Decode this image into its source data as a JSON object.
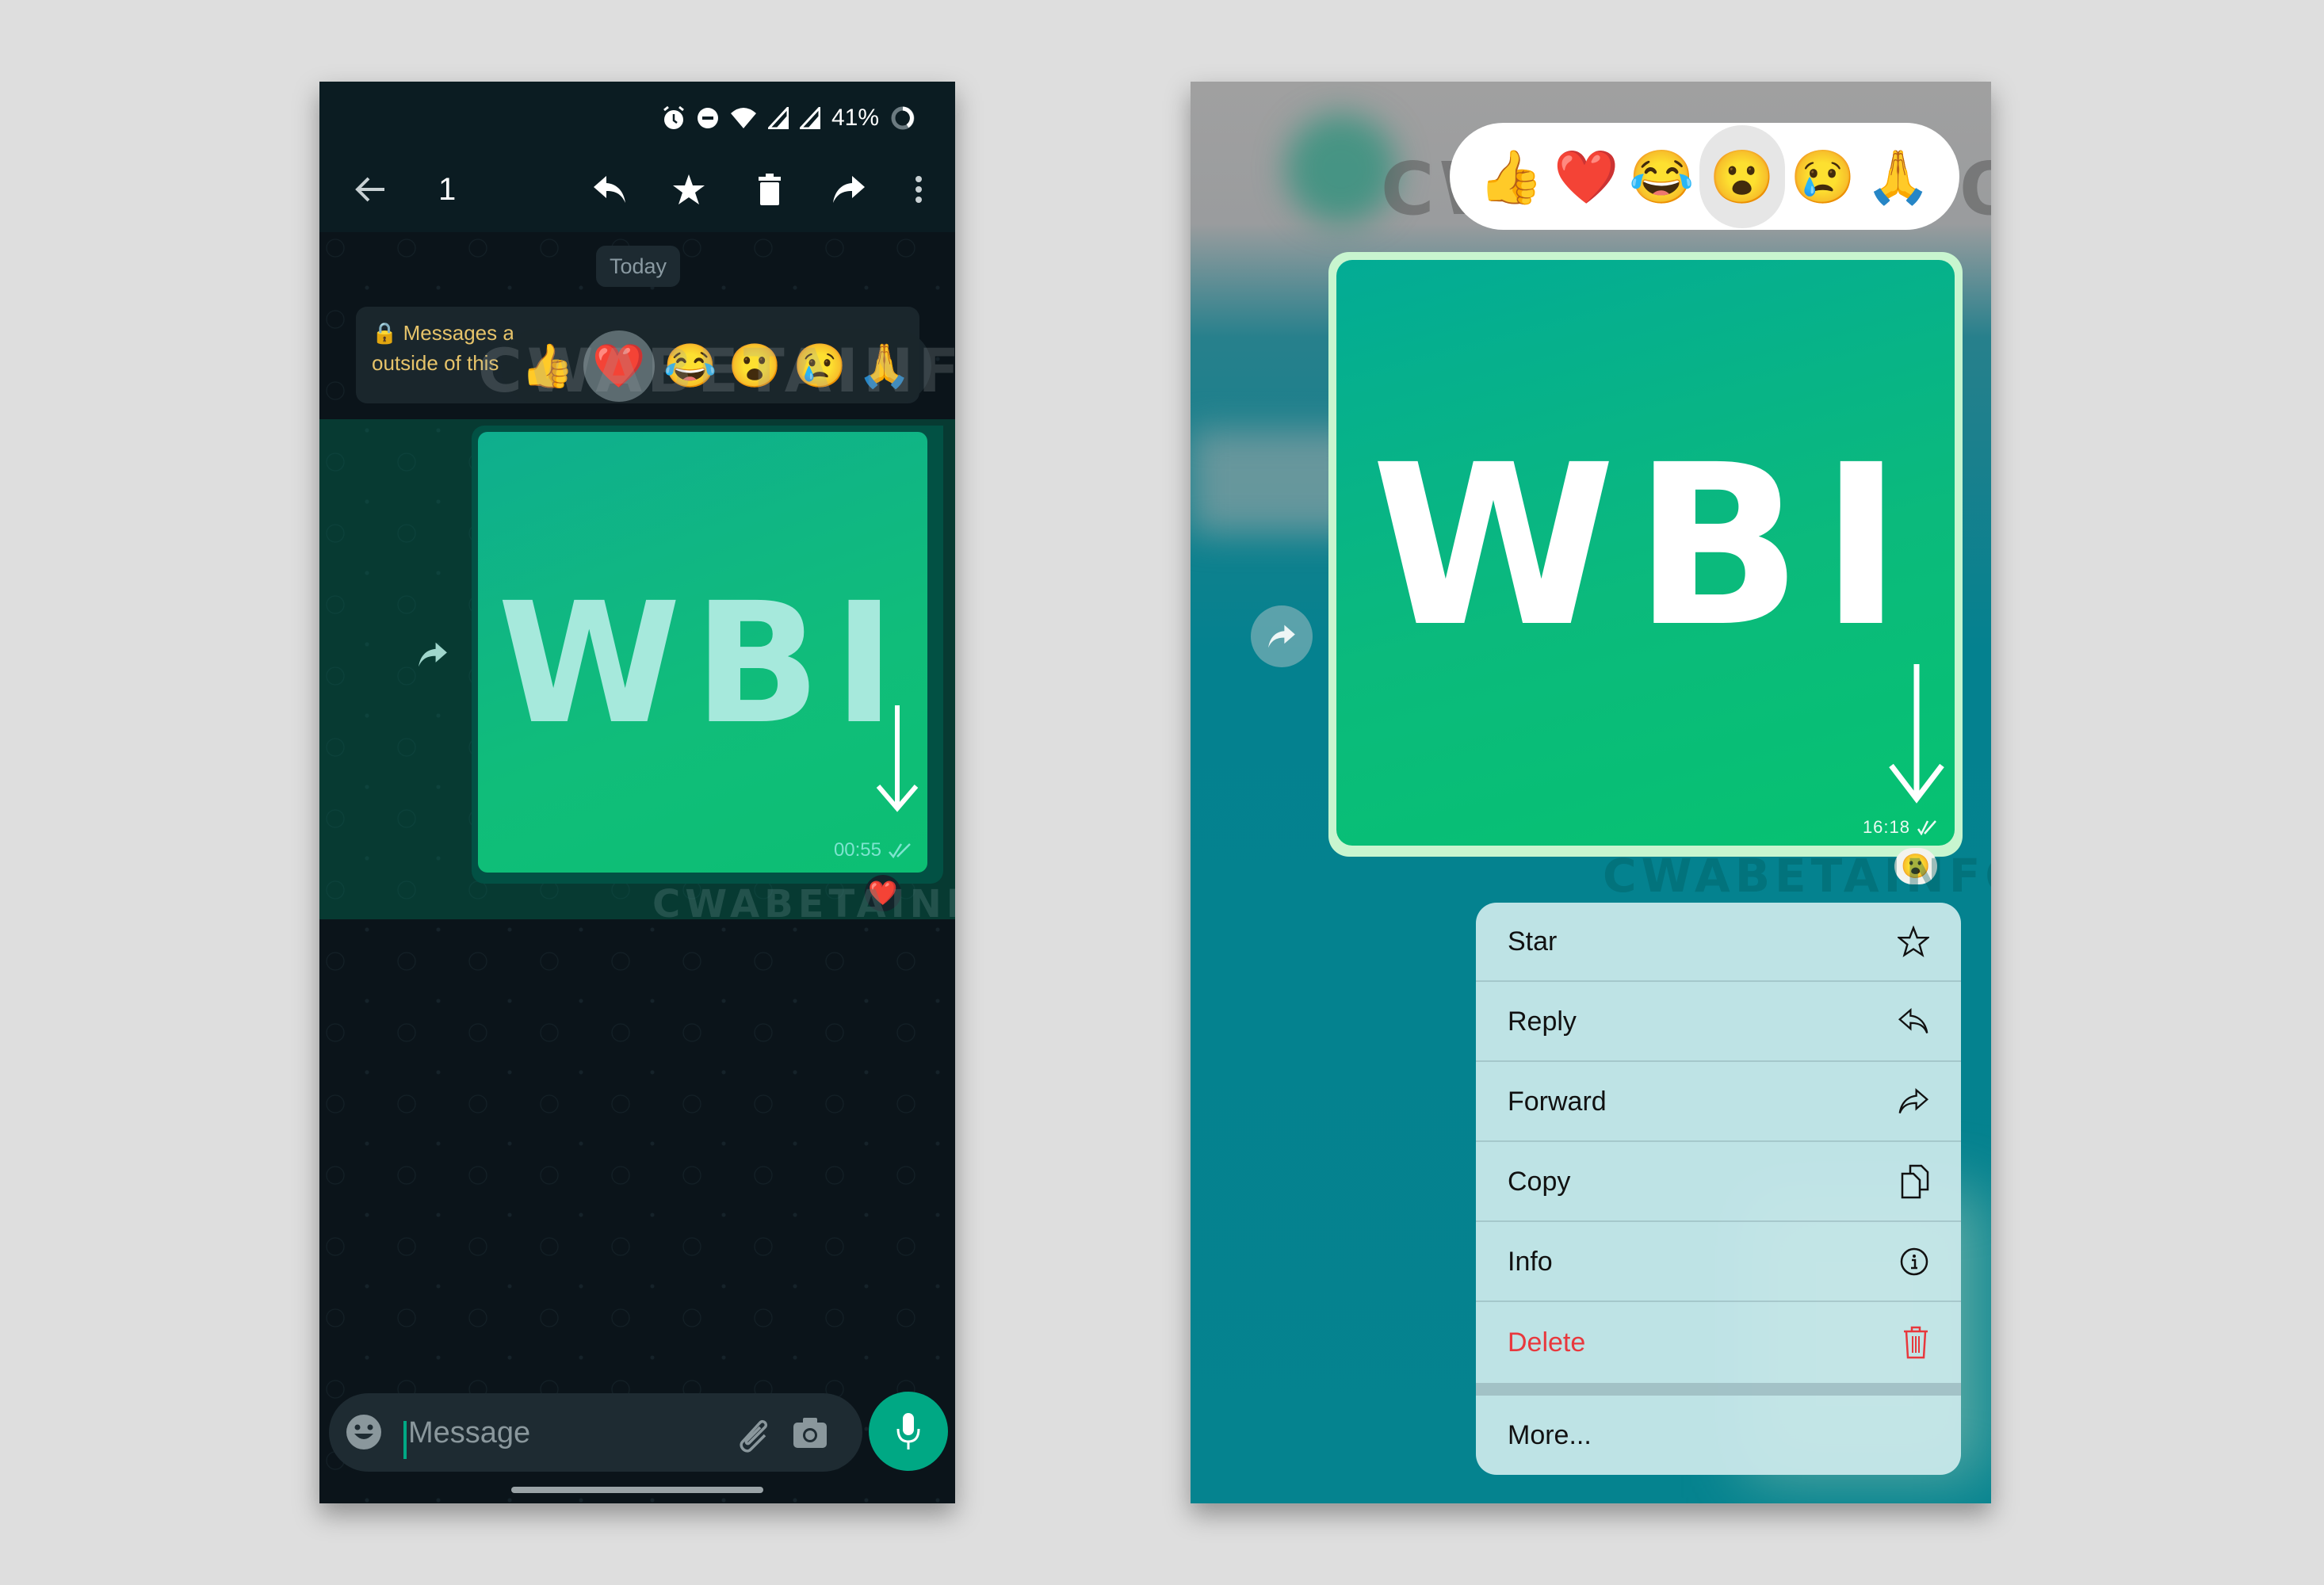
{
  "left_screen": {
    "status_bar": {
      "icons": [
        "alarm-icon",
        "do-not-disturb-icon",
        "wifi-icon",
        "signal-icon",
        "signal-icon"
      ],
      "battery_percent": "41%"
    },
    "toolbar": {
      "back_icon": "arrow-left-icon",
      "selected_count": "1",
      "actions": [
        "reply-icon",
        "star-icon",
        "delete-icon",
        "forward-icon",
        "more-vertical-icon"
      ]
    },
    "date_pill": "Today",
    "encryption_notice": {
      "line1": "Messages a",
      "line2": "outside of this"
    },
    "reactions": [
      "👍",
      "❤️",
      "😂",
      "😮",
      "😢",
      "🙏"
    ],
    "selected_reaction_index": 1,
    "message": {
      "image_text": "WBI",
      "time": "00:55",
      "status": "read",
      "reaction": "❤️"
    },
    "watermark": "CWABETAINFO",
    "composer": {
      "placeholder": "Message"
    },
    "colors": {
      "accent": "#00a884",
      "background": "#0b141a",
      "bubble": "#025144"
    }
  },
  "right_screen": {
    "reactions": [
      "👍",
      "❤️",
      "😂",
      "😮",
      "😢",
      "🙏"
    ],
    "selected_reaction_index": 3,
    "message": {
      "image_text": "WBI",
      "time": "16:18",
      "status": "read",
      "reaction": "😮"
    },
    "watermark": "CWABETAINFO",
    "context_menu": [
      {
        "label": "Star",
        "icon": "star-outline-icon"
      },
      {
        "label": "Reply",
        "icon": "reply-icon"
      },
      {
        "label": "Forward",
        "icon": "forward-icon"
      },
      {
        "label": "Copy",
        "icon": "copy-icon"
      },
      {
        "label": "Info",
        "icon": "info-icon"
      },
      {
        "label": "Delete",
        "icon": "trash-icon"
      }
    ],
    "more_label": "More...",
    "colors": {
      "delete": "#e8383d",
      "background": "#05838f",
      "bubble_border": "#c8f5cf"
    }
  }
}
